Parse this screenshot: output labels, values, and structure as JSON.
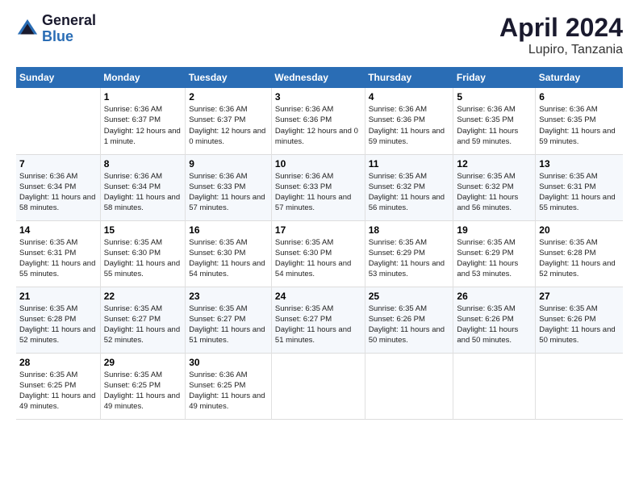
{
  "header": {
    "logo_general": "General",
    "logo_blue": "Blue",
    "title": "April 2024",
    "location": "Lupiro, Tanzania"
  },
  "days_of_week": [
    "Sunday",
    "Monday",
    "Tuesday",
    "Wednesday",
    "Thursday",
    "Friday",
    "Saturday"
  ],
  "weeks": [
    [
      {
        "day": "",
        "sunrise": "",
        "sunset": "",
        "daylight": ""
      },
      {
        "day": "1",
        "sunrise": "Sunrise: 6:36 AM",
        "sunset": "Sunset: 6:37 PM",
        "daylight": "Daylight: 12 hours and 1 minute."
      },
      {
        "day": "2",
        "sunrise": "Sunrise: 6:36 AM",
        "sunset": "Sunset: 6:37 PM",
        "daylight": "Daylight: 12 hours and 0 minutes."
      },
      {
        "day": "3",
        "sunrise": "Sunrise: 6:36 AM",
        "sunset": "Sunset: 6:36 PM",
        "daylight": "Daylight: 12 hours and 0 minutes."
      },
      {
        "day": "4",
        "sunrise": "Sunrise: 6:36 AM",
        "sunset": "Sunset: 6:36 PM",
        "daylight": "Daylight: 11 hours and 59 minutes."
      },
      {
        "day": "5",
        "sunrise": "Sunrise: 6:36 AM",
        "sunset": "Sunset: 6:35 PM",
        "daylight": "Daylight: 11 hours and 59 minutes."
      },
      {
        "day": "6",
        "sunrise": "Sunrise: 6:36 AM",
        "sunset": "Sunset: 6:35 PM",
        "daylight": "Daylight: 11 hours and 59 minutes."
      }
    ],
    [
      {
        "day": "7",
        "sunrise": "Sunrise: 6:36 AM",
        "sunset": "Sunset: 6:34 PM",
        "daylight": "Daylight: 11 hours and 58 minutes."
      },
      {
        "day": "8",
        "sunrise": "Sunrise: 6:36 AM",
        "sunset": "Sunset: 6:34 PM",
        "daylight": "Daylight: 11 hours and 58 minutes."
      },
      {
        "day": "9",
        "sunrise": "Sunrise: 6:36 AM",
        "sunset": "Sunset: 6:33 PM",
        "daylight": "Daylight: 11 hours and 57 minutes."
      },
      {
        "day": "10",
        "sunrise": "Sunrise: 6:36 AM",
        "sunset": "Sunset: 6:33 PM",
        "daylight": "Daylight: 11 hours and 57 minutes."
      },
      {
        "day": "11",
        "sunrise": "Sunrise: 6:35 AM",
        "sunset": "Sunset: 6:32 PM",
        "daylight": "Daylight: 11 hours and 56 minutes."
      },
      {
        "day": "12",
        "sunrise": "Sunrise: 6:35 AM",
        "sunset": "Sunset: 6:32 PM",
        "daylight": "Daylight: 11 hours and 56 minutes."
      },
      {
        "day": "13",
        "sunrise": "Sunrise: 6:35 AM",
        "sunset": "Sunset: 6:31 PM",
        "daylight": "Daylight: 11 hours and 55 minutes."
      }
    ],
    [
      {
        "day": "14",
        "sunrise": "Sunrise: 6:35 AM",
        "sunset": "Sunset: 6:31 PM",
        "daylight": "Daylight: 11 hours and 55 minutes."
      },
      {
        "day": "15",
        "sunrise": "Sunrise: 6:35 AM",
        "sunset": "Sunset: 6:30 PM",
        "daylight": "Daylight: 11 hours and 55 minutes."
      },
      {
        "day": "16",
        "sunrise": "Sunrise: 6:35 AM",
        "sunset": "Sunset: 6:30 PM",
        "daylight": "Daylight: 11 hours and 54 minutes."
      },
      {
        "day": "17",
        "sunrise": "Sunrise: 6:35 AM",
        "sunset": "Sunset: 6:30 PM",
        "daylight": "Daylight: 11 hours and 54 minutes."
      },
      {
        "day": "18",
        "sunrise": "Sunrise: 6:35 AM",
        "sunset": "Sunset: 6:29 PM",
        "daylight": "Daylight: 11 hours and 53 minutes."
      },
      {
        "day": "19",
        "sunrise": "Sunrise: 6:35 AM",
        "sunset": "Sunset: 6:29 PM",
        "daylight": "Daylight: 11 hours and 53 minutes."
      },
      {
        "day": "20",
        "sunrise": "Sunrise: 6:35 AM",
        "sunset": "Sunset: 6:28 PM",
        "daylight": "Daylight: 11 hours and 52 minutes."
      }
    ],
    [
      {
        "day": "21",
        "sunrise": "Sunrise: 6:35 AM",
        "sunset": "Sunset: 6:28 PM",
        "daylight": "Daylight: 11 hours and 52 minutes."
      },
      {
        "day": "22",
        "sunrise": "Sunrise: 6:35 AM",
        "sunset": "Sunset: 6:27 PM",
        "daylight": "Daylight: 11 hours and 52 minutes."
      },
      {
        "day": "23",
        "sunrise": "Sunrise: 6:35 AM",
        "sunset": "Sunset: 6:27 PM",
        "daylight": "Daylight: 11 hours and 51 minutes."
      },
      {
        "day": "24",
        "sunrise": "Sunrise: 6:35 AM",
        "sunset": "Sunset: 6:27 PM",
        "daylight": "Daylight: 11 hours and 51 minutes."
      },
      {
        "day": "25",
        "sunrise": "Sunrise: 6:35 AM",
        "sunset": "Sunset: 6:26 PM",
        "daylight": "Daylight: 11 hours and 50 minutes."
      },
      {
        "day": "26",
        "sunrise": "Sunrise: 6:35 AM",
        "sunset": "Sunset: 6:26 PM",
        "daylight": "Daylight: 11 hours and 50 minutes."
      },
      {
        "day": "27",
        "sunrise": "Sunrise: 6:35 AM",
        "sunset": "Sunset: 6:26 PM",
        "daylight": "Daylight: 11 hours and 50 minutes."
      }
    ],
    [
      {
        "day": "28",
        "sunrise": "Sunrise: 6:35 AM",
        "sunset": "Sunset: 6:25 PM",
        "daylight": "Daylight: 11 hours and 49 minutes."
      },
      {
        "day": "29",
        "sunrise": "Sunrise: 6:35 AM",
        "sunset": "Sunset: 6:25 PM",
        "daylight": "Daylight: 11 hours and 49 minutes."
      },
      {
        "day": "30",
        "sunrise": "Sunrise: 6:36 AM",
        "sunset": "Sunset: 6:25 PM",
        "daylight": "Daylight: 11 hours and 49 minutes."
      },
      {
        "day": "",
        "sunrise": "",
        "sunset": "",
        "daylight": ""
      },
      {
        "day": "",
        "sunrise": "",
        "sunset": "",
        "daylight": ""
      },
      {
        "day": "",
        "sunrise": "",
        "sunset": "",
        "daylight": ""
      },
      {
        "day": "",
        "sunrise": "",
        "sunset": "",
        "daylight": ""
      }
    ]
  ]
}
